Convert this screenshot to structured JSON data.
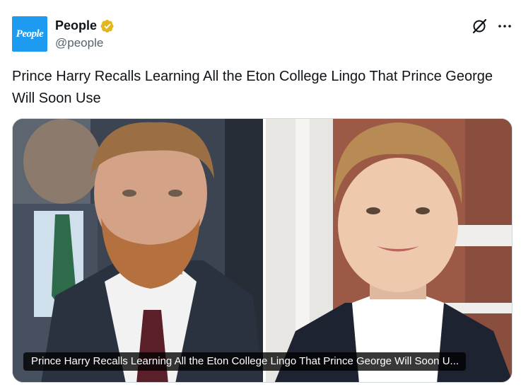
{
  "account": {
    "avatar_text": "People",
    "name": "People",
    "handle": "@people",
    "verified_badge": "gold-verified-badge-icon",
    "brand_color": "#1d9bf0"
  },
  "header_icons": [
    "grok-icon",
    "more-options-icon"
  ],
  "tweet": {
    "text": "Prince Harry Recalls Learning All the Eton College Lingo That Prince George Will Soon Use"
  },
  "card": {
    "caption": "Prince Harry Recalls Learning All the Eton College Lingo That Prince George Will Soon U...",
    "images": [
      "prince-harry-photo",
      "prince-george-photo"
    ]
  }
}
